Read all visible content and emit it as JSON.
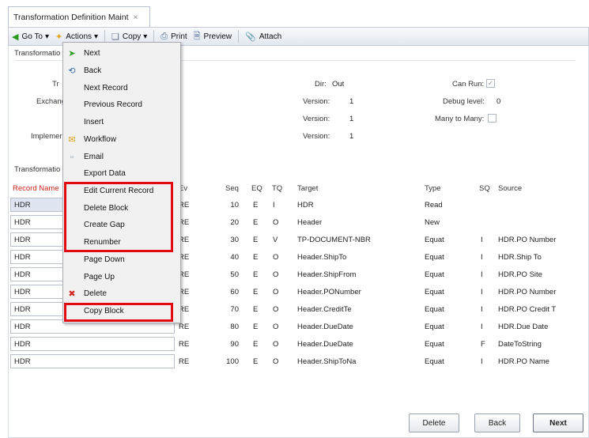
{
  "tab": {
    "title": "Transformation Definition Maint",
    "close": "×"
  },
  "toolbar": {
    "goto": "Go To",
    "actions": "Actions",
    "copy": "Copy",
    "print": "Print",
    "preview": "Preview",
    "attach": "Attach",
    "dropdown": "▾"
  },
  "form": {
    "section_label": "Transformatio",
    "label_tr": "Tr",
    "label_exchange": "Exchang",
    "label_implement": "Implemer",
    "dir_label": "Dir:",
    "dir_value": "Out",
    "version_label": "Version:",
    "version1": "1",
    "version2": "1",
    "version3": "1",
    "can_run_label": "Can Run:",
    "can_run_check": "✓",
    "debug_label": "Debug level:",
    "debug_value": "0",
    "many_label": "Many to Many:",
    "grid_section_label": "Transformatio"
  },
  "grid": {
    "headers": {
      "record_name": "Record Name",
      "ev": "Ev",
      "seq": "Seq",
      "eq": "EQ",
      "tq": "TQ",
      "target": "Target",
      "type": "Type",
      "sq": "SQ",
      "source": "Source"
    },
    "rows": [
      {
        "rec": "HDR",
        "ev": "RE",
        "seq": "10",
        "eq": "E",
        "tq": "I",
        "target": "HDR",
        "type": "Read",
        "sq": "",
        "source": ""
      },
      {
        "rec": "HDR",
        "ev": "RE",
        "seq": "20",
        "eq": "E",
        "tq": "O",
        "target": "Header",
        "type": "New",
        "sq": "",
        "source": ""
      },
      {
        "rec": "HDR",
        "ev": "RE",
        "seq": "30",
        "eq": "E",
        "tq": "V",
        "target": "TP-DOCUMENT-NBR",
        "type": "Equat",
        "sq": "I",
        "source": "HDR.PO Number"
      },
      {
        "rec": "HDR",
        "ev": "RE",
        "seq": "40",
        "eq": "E",
        "tq": "O",
        "target": "Header.ShipTo",
        "type": "Equat",
        "sq": "I",
        "source": "HDR.Ship To"
      },
      {
        "rec": "HDR",
        "ev": "RE",
        "seq": "50",
        "eq": "E",
        "tq": "O",
        "target": "Header.ShipFrom",
        "type": "Equat",
        "sq": "I",
        "source": "HDR.PO Site"
      },
      {
        "rec": "HDR",
        "ev": "RE",
        "seq": "60",
        "eq": "E",
        "tq": "O",
        "target": "Header.PONumber",
        "type": "Equat",
        "sq": "I",
        "source": "HDR.PO Number"
      },
      {
        "rec": "HDR",
        "ev": "RE",
        "seq": "70",
        "eq": "E",
        "tq": "O",
        "target": "Header.CreditTe",
        "type": "Equat",
        "sq": "I",
        "source": "HDR.PO Credit T"
      },
      {
        "rec": "HDR",
        "ev": "RE",
        "seq": "80",
        "eq": "E",
        "tq": "O",
        "target": "Header.DueDate",
        "type": "Equat",
        "sq": "I",
        "source": "HDR.Due Date"
      },
      {
        "rec": "HDR",
        "ev": "RE",
        "seq": "90",
        "eq": "E",
        "tq": "O",
        "target": "Header.DueDate",
        "type": "Equat",
        "sq": "F",
        "source": "DateToString"
      },
      {
        "rec": "HDR",
        "ev": "RE",
        "seq": "100",
        "eq": "E",
        "tq": "O",
        "target": "Header.ShipToNa",
        "type": "Equat",
        "sq": "I",
        "source": "HDR.PO Name"
      }
    ]
  },
  "menu": {
    "items": [
      {
        "label": "Next",
        "icon": "green-arrow-icon"
      },
      {
        "label": "Back",
        "icon": "undo-arrow-icon"
      },
      {
        "label": "Next Record",
        "icon": ""
      },
      {
        "label": "Previous Record",
        "icon": ""
      },
      {
        "label": "Insert",
        "icon": ""
      },
      {
        "label": "Workflow",
        "icon": "envelope-icon"
      },
      {
        "label": "Email",
        "icon": "email-icon"
      },
      {
        "label": "Export Data",
        "icon": ""
      },
      {
        "label": "Edit Current Record",
        "icon": ""
      },
      {
        "label": "Delete Block",
        "icon": ""
      },
      {
        "label": "Create Gap",
        "icon": ""
      },
      {
        "label": "Renumber",
        "icon": ""
      },
      {
        "label": "Page Down",
        "icon": ""
      },
      {
        "label": "Page Up",
        "icon": ""
      },
      {
        "label": "Delete",
        "icon": "red-x-icon"
      },
      {
        "label": "Copy Block",
        "icon": ""
      }
    ]
  },
  "buttons": {
    "delete": "Delete",
    "back": "Back",
    "next": "Next"
  },
  "colors": {
    "highlight": "#e20a10",
    "record_name_header": "#d0261c"
  }
}
